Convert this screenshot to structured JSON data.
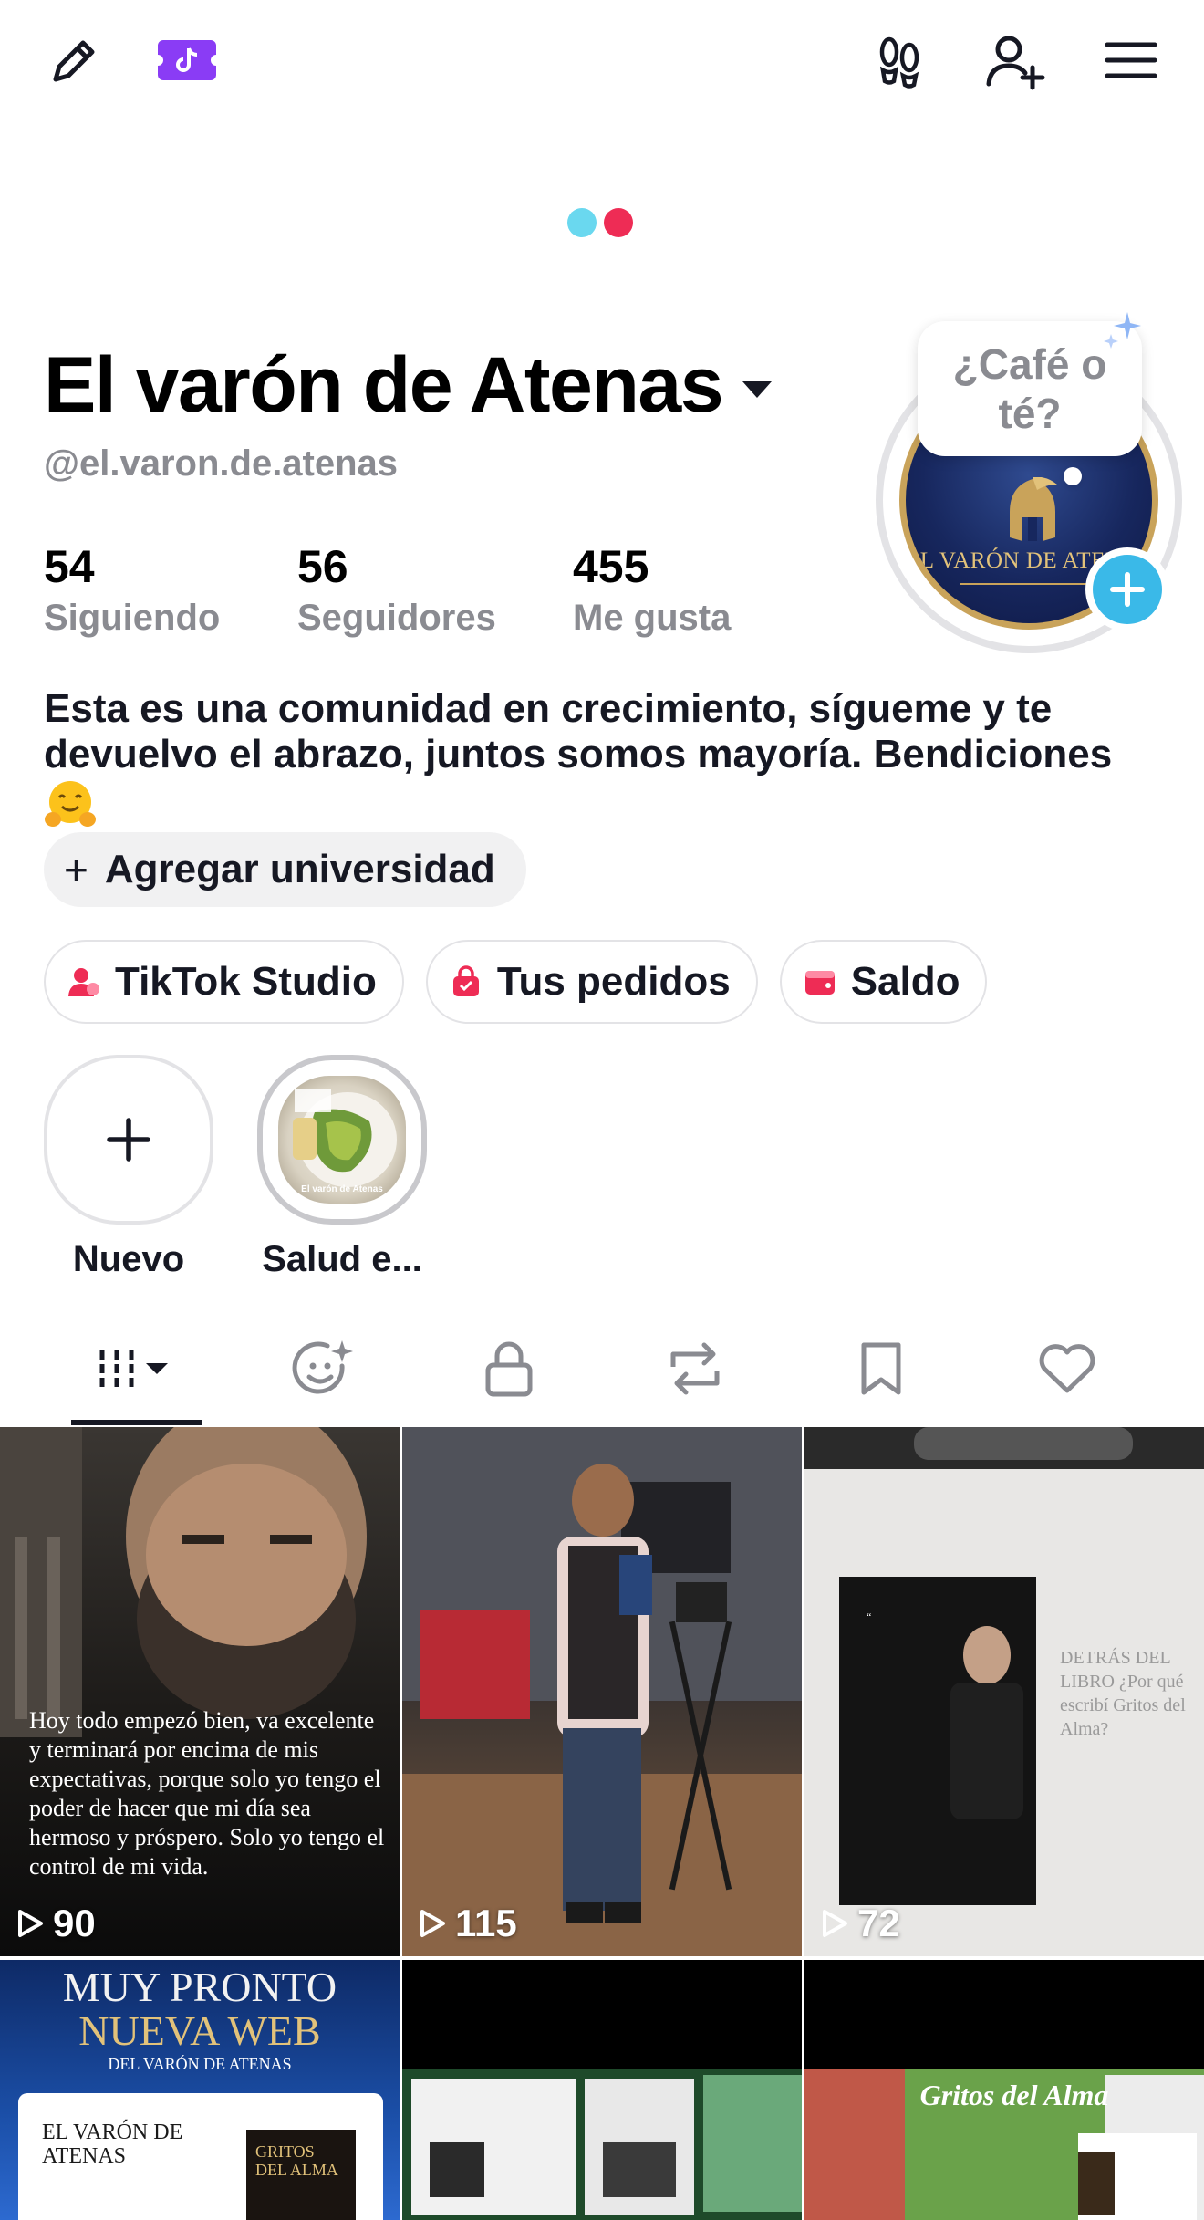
{
  "topbar": {
    "edit_icon": "pencil-icon",
    "creator_icon": "tiktok-music-badge-icon",
    "footprints_icon": "footprints-icon",
    "add_user_icon": "add-friend-icon",
    "menu_icon": "hamburger-menu-icon"
  },
  "loader": {
    "colors": [
      "#6ad8ef",
      "#ee2c55"
    ]
  },
  "profile": {
    "display_name": "El varón de Atenas",
    "username": "@el.varon.de.atenas",
    "stats": [
      {
        "value": "54",
        "label": "Siguiendo"
      },
      {
        "value": "56",
        "label": "Seguidores"
      },
      {
        "value": "455",
        "label": "Me gusta"
      }
    ],
    "bubble_text": "¿Café o té?",
    "avatar_brand": "EL VARÓN DE ATENAS",
    "bio": "Esta es una comunidad en crecimiento, sígueme y te devuelvo el abrazo, juntos somos mayoría. Bendiciones",
    "bio_emoji": "hugging-face-emoji",
    "add_university": "Agregar universidad"
  },
  "action_pills": [
    {
      "label": "TikTok Studio",
      "icon": "studio-person-icon",
      "color": "#ee2c55"
    },
    {
      "label": "Tus pedidos",
      "icon": "shopping-bag-icon",
      "color": "#ee2c55"
    },
    {
      "label": "Saldo",
      "icon": "wallet-icon",
      "color": "#ee2c55"
    }
  ],
  "highlights": [
    {
      "label": "Nuevo",
      "icon": "plus-icon"
    },
    {
      "label": "Salud e...",
      "thumb_caption": "El varón de Atenas"
    }
  ],
  "tabs": [
    {
      "name": "videos-grid",
      "icon": "grid-bars-icon",
      "active": true
    },
    {
      "name": "ai-self",
      "icon": "sparkle-face-icon"
    },
    {
      "name": "private",
      "icon": "lock-icon"
    },
    {
      "name": "reposts",
      "icon": "repost-icon"
    },
    {
      "name": "favorites",
      "icon": "bookmark-icon"
    },
    {
      "name": "liked",
      "icon": "heart-icon"
    }
  ],
  "videos": [
    {
      "views": "90",
      "overlay": "Hoy todo empezó bien, va excelente y terminará por encima de mis expectativas, porque solo yo tengo el poder de hacer que mi día sea hermoso y próspero. Solo yo tengo el control de mi vida."
    },
    {
      "views": "115"
    },
    {
      "views": "72",
      "overlay": "DETRÁS DEL LIBRO ¿Por qué escribí Gritos del Alma?"
    },
    {
      "overlay_title": "MUY PRONTO",
      "overlay_sub": "NUEVA WEB",
      "overlay_small": "DEL VARÓN DE ATENAS",
      "overlay_brand": "EL VARÓN DE ATENAS",
      "overlay_book": "GRITOS DEL ALMA"
    },
    {
      "overlay": ""
    },
    {
      "overlay_title": "Gritos del Alma"
    }
  ]
}
